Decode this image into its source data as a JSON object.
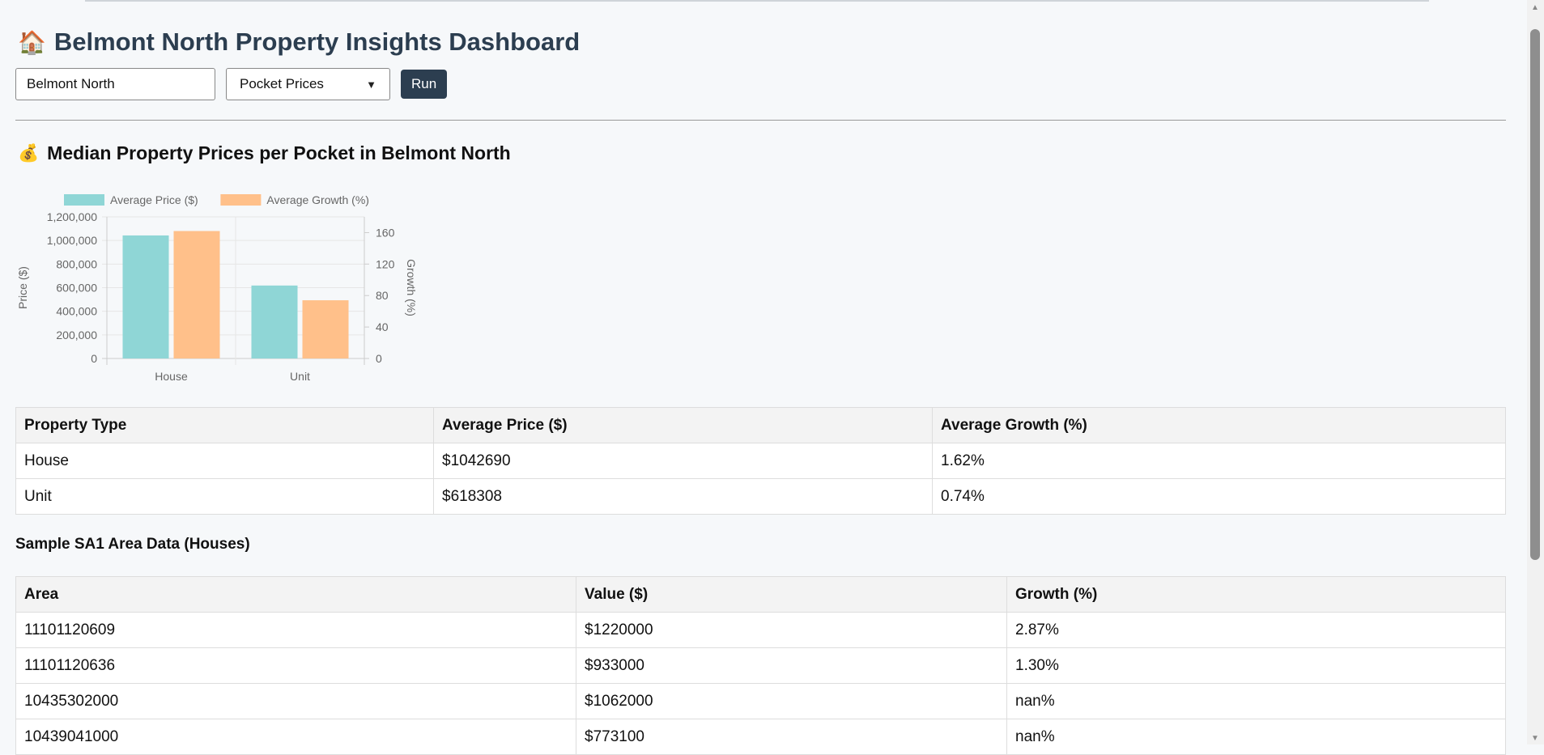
{
  "header": {
    "icon": "house-icon",
    "title": "Belmont North Property Insights Dashboard"
  },
  "controls": {
    "suburb_value": "Belmont North",
    "report_selected": "Pocket Prices",
    "run_label": "Run"
  },
  "section": {
    "icon": "money-bag-icon",
    "title": "Median Property Prices per Pocket in Belmont North"
  },
  "chart_data": {
    "type": "bar",
    "categories": [
      "House",
      "Unit"
    ],
    "series": [
      {
        "name": "Average Price ($)",
        "axis": "left",
        "color": "#8fd6d6",
        "values": [
          1042690,
          618308
        ]
      },
      {
        "name": "Average Growth (%)",
        "axis": "right",
        "color": "#ffc08a",
        "values": [
          162,
          74
        ]
      }
    ],
    "ylabel": "Price ($)",
    "y2label": "Growth (%)",
    "ylim": [
      0,
      1200000
    ],
    "y2lim": [
      0,
      180
    ],
    "yticks": [
      "0",
      "200,000",
      "400,000",
      "600,000",
      "800,000",
      "1,000,000",
      "1,200,000"
    ],
    "y2ticks": [
      "0",
      "40",
      "80",
      "120",
      "160"
    ],
    "legend": "top",
    "grid": true
  },
  "summary_table": {
    "headers": [
      "Property Type",
      "Average Price ($)",
      "Average Growth (%)"
    ],
    "rows": [
      [
        "House",
        "$1042690",
        "1.62%"
      ],
      [
        "Unit",
        "$618308",
        "0.74%"
      ]
    ]
  },
  "sa1_heading": "Sample SA1 Area Data (Houses)",
  "sa1_table": {
    "headers": [
      "Area",
      "Value ($)",
      "Growth (%)"
    ],
    "rows": [
      [
        "11101120609",
        "$1220000",
        "2.87%"
      ],
      [
        "11101120636",
        "$933000",
        "1.30%"
      ],
      [
        "10435302000",
        "$1062000",
        "nan%"
      ],
      [
        "10439041000",
        "$773100",
        "nan%"
      ]
    ]
  }
}
